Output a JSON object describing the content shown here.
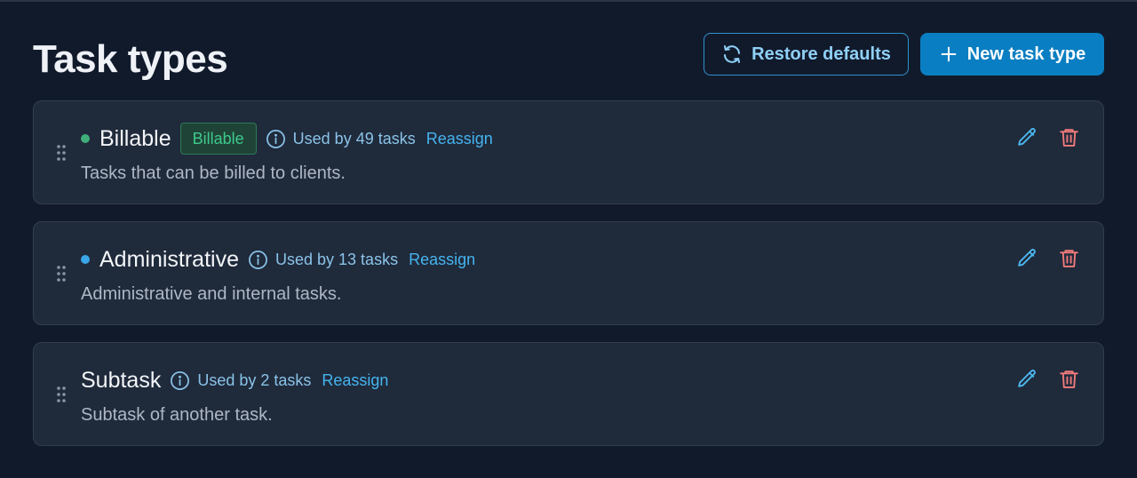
{
  "page": {
    "title": "Task types"
  },
  "header": {
    "restore_label": "Restore defaults",
    "restore_icon": "refresh-icon",
    "new_label": "New task type",
    "new_icon": "plus-icon"
  },
  "colors": {
    "background": "#111a2b",
    "card": "#1f2a3b",
    "accent": "#0a7ec2",
    "link": "#45b4ef",
    "billable_green": "#3ec98c",
    "admin_blue": "#3aa6e8",
    "delete_red": "#f27b7b"
  },
  "task_types": [
    {
      "name": "Billable",
      "dot_color": "#3fae7a",
      "badge": "Billable",
      "usage": "Used by 49 tasks",
      "reassign": "Reassign",
      "description": "Tasks that can be billed to clients."
    },
    {
      "name": "Administrative",
      "dot_color": "#3aa6e8",
      "badge": "",
      "usage": "Used by 13 tasks",
      "reassign": "Reassign",
      "description": "Administrative and internal tasks."
    },
    {
      "name": "Subtask",
      "dot_color": "",
      "badge": "",
      "usage": "Used by 2 tasks",
      "reassign": "Reassign",
      "description": "Subtask of another task."
    }
  ],
  "icons": {
    "drag": "drag-handle-icon",
    "info": "info-icon",
    "edit": "pencil-icon",
    "delete": "trash-icon"
  }
}
